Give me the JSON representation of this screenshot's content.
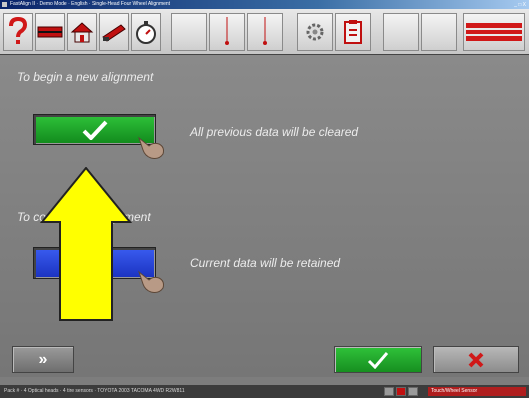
{
  "window": {
    "title": "FastAlign II · Demo Mode · English · Single-Head Four Wheel Alignment",
    "controls": "_ □ X"
  },
  "toolbar": {
    "help_icon": "question-mark-icon",
    "vehicle_icon": "vehicle-icon",
    "home_icon": "home-icon",
    "sensor_icon": "sensor-icon",
    "timer_icon": "stopwatch-icon",
    "logo_icon": "sun-logo-icon"
  },
  "main": {
    "new_alignment_header": "To begin a new alignment",
    "new_alignment_desc": "All previous data will be cleared",
    "continue_alignment_header": "To continue an alignment",
    "continue_alignment_desc": "Current data will be retained"
  },
  "colors": {
    "new_button": "#1fa82a",
    "continue_button": "#1e3ed8",
    "arrow": "#ffff00",
    "accept_button": "#24b02c",
    "cancel_icon": "#d01818"
  },
  "footer": {
    "next_label": "»",
    "accept_icon": "checkmark-icon",
    "cancel_icon": "x-icon"
  },
  "status": {
    "text": "Pack # · 4 Optical heads · 4 tire sensors · TOYOTA 2003 TACOMA 4WD R2W811",
    "right_label": "Touch/Wheel Sensor"
  }
}
